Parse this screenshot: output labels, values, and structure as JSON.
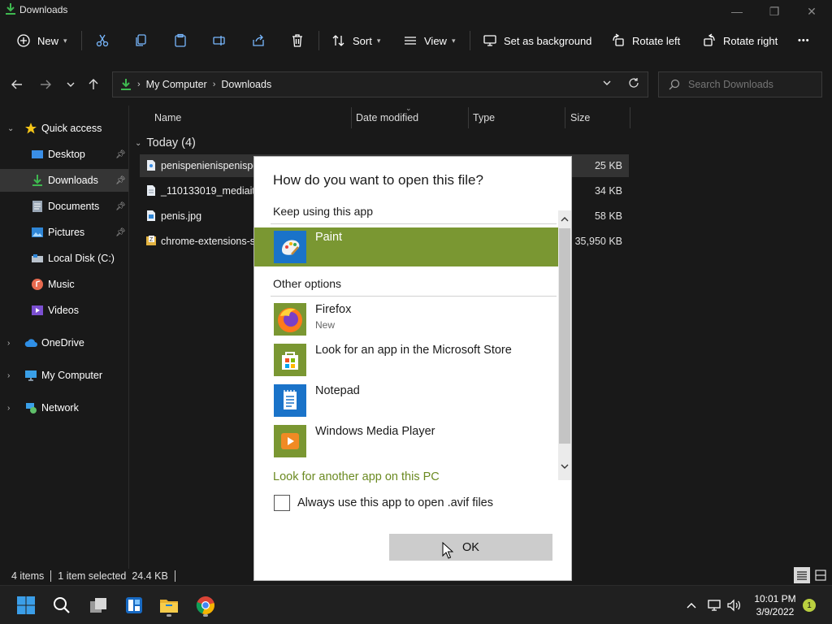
{
  "window": {
    "title": "Downloads",
    "minimize_glyph": "—",
    "maximize_glyph": "❐",
    "close_glyph": "✕"
  },
  "toolbar": {
    "new_label": "New",
    "sort_label": "Sort",
    "view_label": "View",
    "set_background_label": "Set as background",
    "rotate_left_label": "Rotate left",
    "rotate_right_label": "Rotate right",
    "more_glyph": "•••"
  },
  "address": {
    "crumbs": [
      "My Computer",
      "Downloads"
    ],
    "search_placeholder": "Search Downloads"
  },
  "sidebar": {
    "items": [
      {
        "label": "Quick access",
        "icon": "star-icon"
      },
      {
        "label": "Desktop",
        "icon": "desktop-icon",
        "pinned": true
      },
      {
        "label": "Downloads",
        "icon": "download-icon",
        "pinned": true,
        "selected": true
      },
      {
        "label": "Documents",
        "icon": "documents-icon",
        "pinned": true
      },
      {
        "label": "Pictures",
        "icon": "pictures-icon",
        "pinned": true
      },
      {
        "label": "Local Disk (C:)",
        "icon": "disk-icon"
      },
      {
        "label": "Music",
        "icon": "music-icon"
      },
      {
        "label": "Videos",
        "icon": "videos-icon"
      },
      {
        "label": "OneDrive",
        "icon": "cloud-icon"
      },
      {
        "label": "My Computer",
        "icon": "computer-icon"
      },
      {
        "label": "Network",
        "icon": "network-icon"
      }
    ]
  },
  "file_list": {
    "columns": [
      "Name",
      "Date modified",
      "Type",
      "Size"
    ],
    "group_label": "Today (4)",
    "rows": [
      {
        "name": "penispenienispenispe",
        "size": "25 KB",
        "selected": true
      },
      {
        "name": "_110133019_mediaiter",
        "size": "34 KB"
      },
      {
        "name": "penis.jpg",
        "size": "58 KB"
      },
      {
        "name": "chrome-extensions-sa",
        "size": "35,950 KB"
      }
    ]
  },
  "status": {
    "items_count": "4 items",
    "selection": "1 item selected  24.4 KB"
  },
  "dialog": {
    "title": "How do you want to open this file?",
    "keep_label": "Keep using this app",
    "current_app": "Paint",
    "other_label": "Other options",
    "apps": [
      {
        "name": "Firefox",
        "sub": "New",
        "icon": "firefox-icon"
      },
      {
        "name": "Look for an app in the Microsoft Store",
        "sub": "",
        "icon": "store-icon"
      },
      {
        "name": "Notepad",
        "sub": "",
        "icon": "notepad-icon"
      },
      {
        "name": "Windows Media Player",
        "sub": "",
        "icon": "media-player-icon"
      }
    ],
    "another_app_link": "Look for another app on this PC",
    "always_use_label": "Always use this app to open .avif files",
    "ok_label": "OK",
    "accent_color": "#7a9732"
  },
  "taskbar": {
    "time": "10:01 PM",
    "date": "3/9/2022",
    "notification_count": "1"
  }
}
